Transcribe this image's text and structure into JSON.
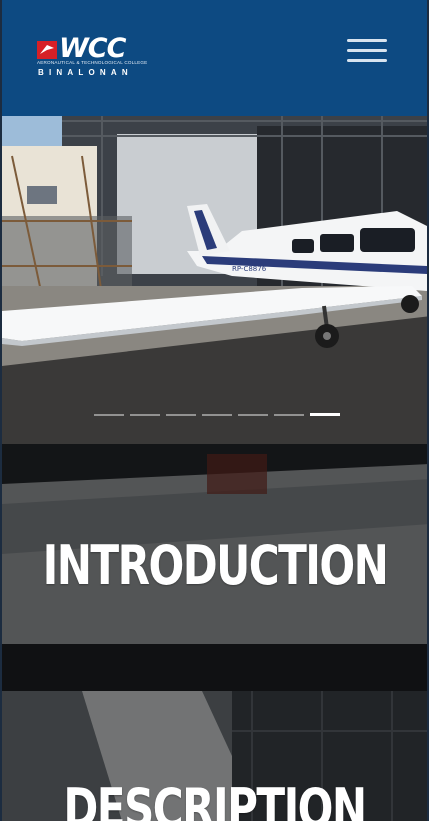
{
  "header": {
    "logo_text": "WCC",
    "logo_subtitle": "AERONAUTICAL & TECHNOLOGICAL COLLEGE",
    "logo_campus": "BINALONAN",
    "menu_icon": "hamburger-menu-icon"
  },
  "hero": {
    "slides_count": 7,
    "active_slide": 7,
    "aircraft_reg": "RP-C8876"
  },
  "sections": [
    {
      "title": "INTRODUCTION"
    },
    {
      "title": "DESCRIPTION"
    }
  ],
  "colors": {
    "header_bg": "#0d4a82",
    "text": "#ffffff"
  }
}
